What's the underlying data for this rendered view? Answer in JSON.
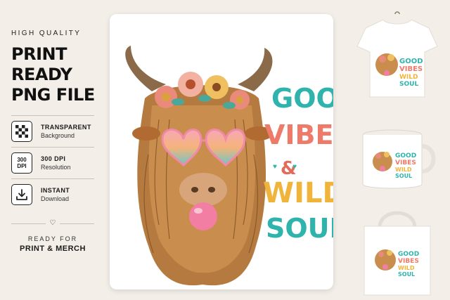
{
  "left": {
    "eyebrow": "HIGH QUALITY",
    "headline": [
      "PRINT READY",
      "PNG FILE"
    ],
    "features": [
      {
        "icon": "checkerboard-icon",
        "title": "TRANSPARENT",
        "subtitle": "Background"
      },
      {
        "icon_text": [
          "300",
          "DPI"
        ],
        "title": "300 DPI",
        "subtitle": "Resolution"
      },
      {
        "icon": "download-icon",
        "title": "INSTANT",
        "subtitle": "Download"
      }
    ],
    "ready_line1": "READY FOR",
    "ready_line2": "PRINT & MERCH"
  },
  "design": {
    "words": [
      "GOOD",
      "VIBES",
      "&",
      "WILD",
      "SOUL"
    ],
    "colors": {
      "good": "#2fb3ad",
      "vibes": "#ee7b6a",
      "amp": "#e26b5a",
      "wild": "#f0b43a",
      "soul": "#2fb3ad"
    }
  },
  "mockups": [
    "t-shirt",
    "mug",
    "tote-bag"
  ]
}
